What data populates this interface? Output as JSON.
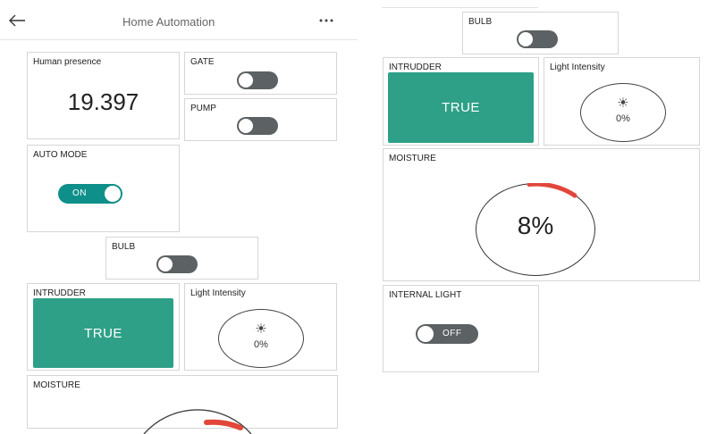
{
  "header": {
    "title": "Home Automation",
    "back_icon": "arrow-left-icon",
    "menu_icon": "more-horizontal-icon"
  },
  "left": {
    "human_presence": {
      "label": "Human presence",
      "value": "19.397"
    },
    "gate": {
      "label": "GATE",
      "state": "off"
    },
    "pump": {
      "label": "PUMP",
      "state": "off"
    },
    "auto_mode": {
      "label": "AUTO MODE",
      "state_text": "ON"
    },
    "bulb": {
      "label": "BULB",
      "state": "off"
    },
    "intruder": {
      "label": "INTRUDDER",
      "value": "TRUE"
    },
    "light_intensity": {
      "label": "Light Intensity",
      "icon": "sun-icon",
      "value": "0%"
    },
    "moisture": {
      "label": "MOISTURE"
    }
  },
  "right": {
    "bulb": {
      "label": "BULB",
      "state": "off"
    },
    "intruder": {
      "label": "INTRUDDER",
      "value": "TRUE"
    },
    "light_intensity": {
      "label": "Light Intensity",
      "icon": "sun-icon",
      "value": "0%"
    },
    "moisture": {
      "label": "MOISTURE",
      "value": "8%"
    },
    "internal_light": {
      "label": "INTERNAL LIGHT",
      "state_text": "OFF"
    }
  },
  "colors": {
    "accent_teal": "#0f8f8a",
    "true_green": "#2ea087",
    "moisture_arc": "#e2463a",
    "toggle_off": "#5c6163"
  }
}
